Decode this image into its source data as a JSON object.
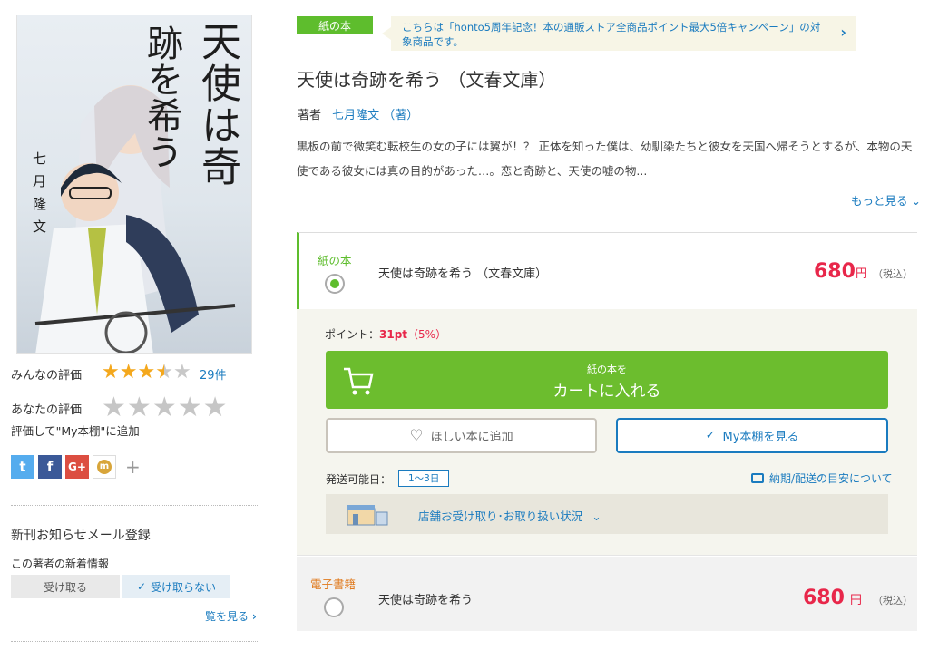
{
  "cover": {
    "title_line1": "天使は奇",
    "title_line2": "跡を希う",
    "author_vertical": "七月隆文"
  },
  "left": {
    "rating_label": "みんなの評価",
    "rating_value": 3.5,
    "rating_count": "29件",
    "your_rating_label": "あなたの評価",
    "add_shelf_text": "評価して\"My本棚\"に追加",
    "notify_title": "新刊お知らせメール登録",
    "notify_sub": "この著者の新着情報",
    "receive_label": "受け取る",
    "no_receive_label": "受け取らない",
    "list_link": "一覧を見る"
  },
  "header": {
    "paper_tag": "紙の本",
    "banner_text": "こちらは「honto5周年記念！本の通販ストア全商品ポイント最大5倍キャンペーン」の対象商品です。",
    "title": "天使は奇跡を希う （文春文庫）",
    "author_label": "著者",
    "author_name": "七月隆文 （著）",
    "description": "黒板の前で微笑む転校生の女の子には翼が！？ 正体を知った僕は、幼馴染たちと彼女を天国へ帰そうとするが、本物の天使である彼女には真の目的があった…。恋と奇跡と、天使の嘘の物...",
    "more_link": "もっと見る"
  },
  "paper": {
    "label": "紙の本",
    "item_title": "天使は奇跡を希う （文春文庫）",
    "price": "680",
    "yen": "円",
    "tax": "（税込）",
    "points_label": "ポイント：",
    "points_value": "31pt",
    "points_rate": "（5%）",
    "cart_small": "紙の本を",
    "cart_main": "カートに入れる",
    "wish_label": "ほしい本に追加",
    "shelf_label": "My本棚を見る",
    "ship_label": "発送可能日：",
    "ship_value": "1～3日",
    "delivery_link": "納期/配送の目安について",
    "store_label": "店舗お受け取り･お取り扱い状況"
  },
  "ebook": {
    "label": "電子書籍",
    "item_title": "天使は奇跡を希う",
    "price": "680",
    "yen": "円",
    "tax": "（税込）"
  },
  "colors": {
    "green": "#5ebd2d",
    "price_red": "#e8274a",
    "link_blue": "#1a7bbf",
    "star": "#f4a81d"
  }
}
